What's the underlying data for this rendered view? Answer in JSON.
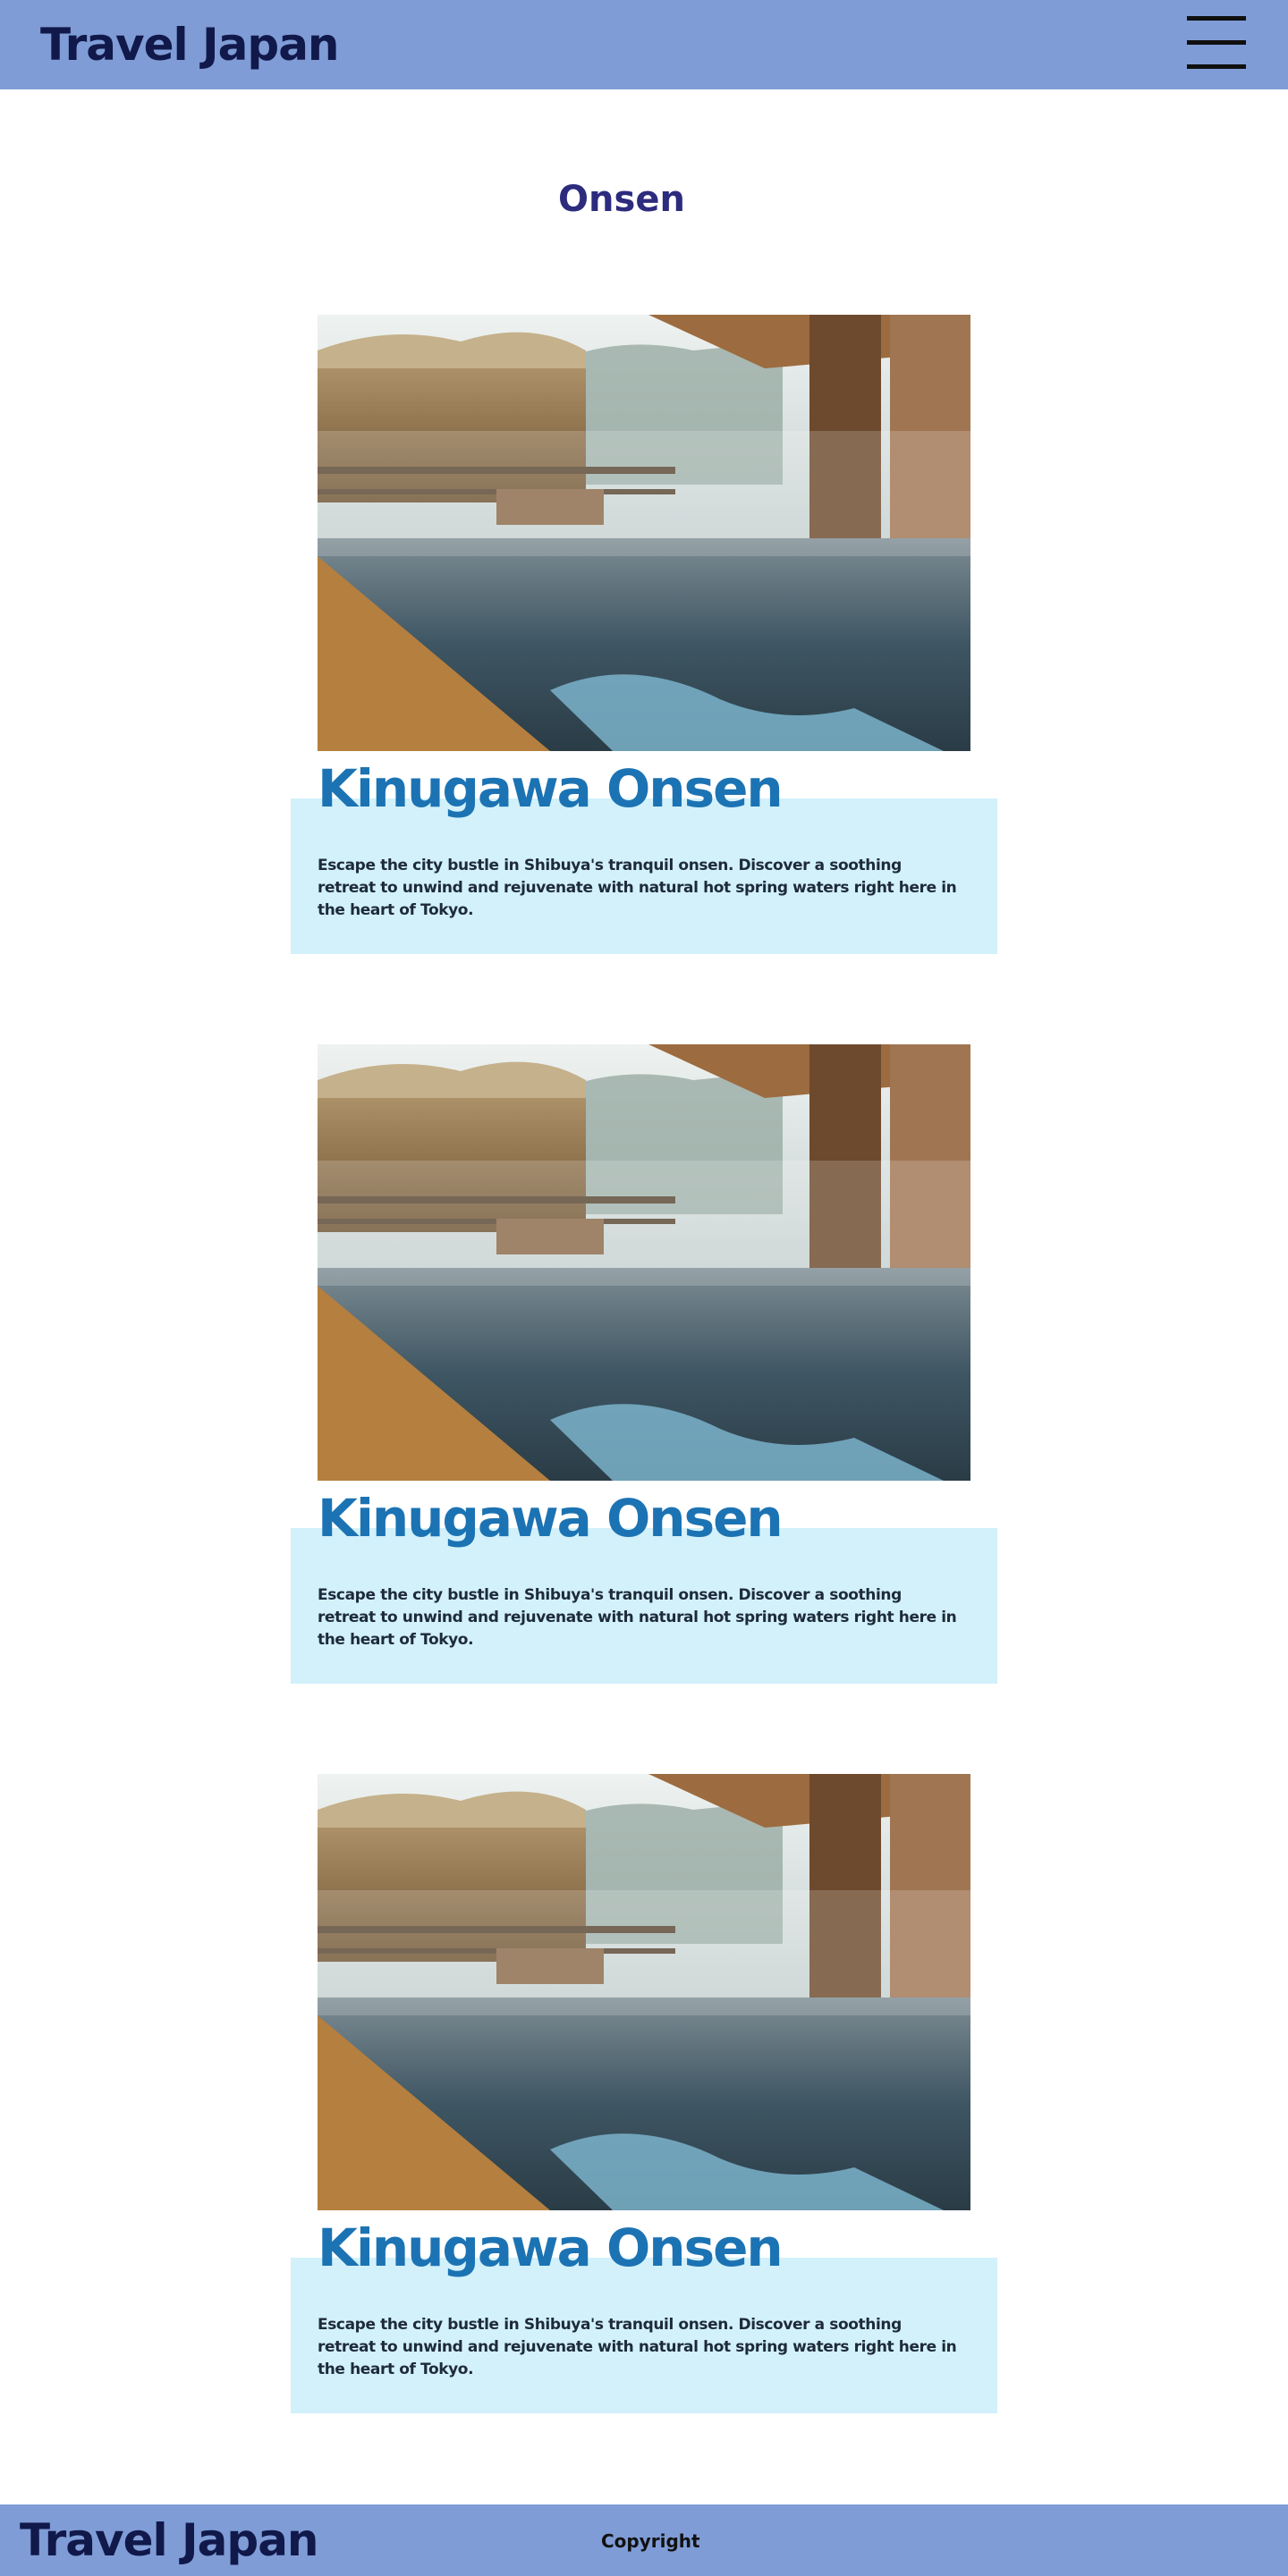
{
  "header": {
    "brand": "Travel Japan",
    "menu_icon": "hamburger-menu-icon"
  },
  "main": {
    "title": "Onsen",
    "cards": [
      {
        "title": "Kinugawa Onsen",
        "description": "Escape the city bustle in Shibuya's tranquil onsen. Discover a soothing retreat to unwind and rejuvenate with natural hot spring waters right here in the heart of Tokyo."
      },
      {
        "title": "Kinugawa Onsen",
        "description": "Escape the city bustle in Shibuya's tranquil onsen. Discover a soothing retreat to unwind and rejuvenate with natural hot spring waters right here in the heart of Tokyo."
      },
      {
        "title": "Kinugawa Onsen",
        "description": "Escape the city bustle in Shibuya's tranquil onsen. Discover a soothing retreat to unwind and rejuvenate with natural hot spring waters right here in the heart of Tokyo."
      }
    ]
  },
  "footer": {
    "brand": "Travel Japan",
    "copyright": "Copyright"
  },
  "colors": {
    "header_bg": "#7f9cd6",
    "card_bg": "#d2f1fb",
    "card_title": "#1c73b3",
    "page_title": "#2c2b7d",
    "brand_text": "#11184a"
  }
}
